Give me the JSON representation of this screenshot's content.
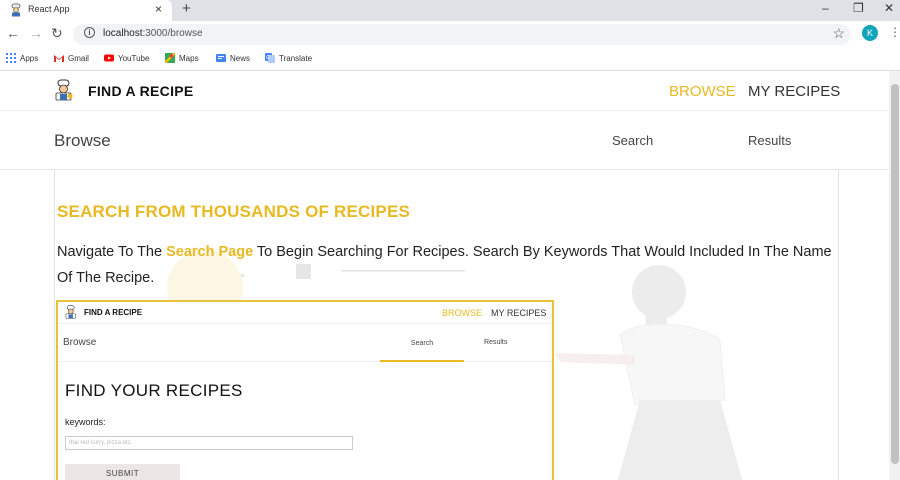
{
  "browser": {
    "tab_title": "React App",
    "tab_close": "×",
    "new_tab": "+",
    "url_host": "localhost",
    "url_path": ":3000/browse",
    "profile_initial": "K",
    "window_controls": [
      "–",
      "❐",
      "✕"
    ],
    "bookmarks": [
      {
        "label": "Apps",
        "icon": "apps-grid-icon",
        "color": "#4285f4"
      },
      {
        "label": "Gmail",
        "icon": "gmail-icon",
        "color": "#d93025"
      },
      {
        "label": "YouTube",
        "icon": "youtube-icon",
        "color": "#ff0000"
      },
      {
        "label": "Maps",
        "icon": "maps-icon",
        "color": "#34a853"
      },
      {
        "label": "News",
        "icon": "news-icon",
        "color": "#4285f4"
      },
      {
        "label": "Translate",
        "icon": "translate-icon",
        "color": "#4285f4"
      }
    ]
  },
  "app": {
    "brand": "FIND A RECIPE",
    "nav_browse": "BROWSE",
    "nav_my_recipes": "MY RECIPES",
    "sub_title": "Browse",
    "sub_search": "Search",
    "sub_results": "Results",
    "accent": "#e8b923"
  },
  "content": {
    "heading": "SEARCH FROM THOUSANDS OF RECIPES",
    "para_before": "Navigate To The ",
    "para_highlight": "Search Page",
    "para_after": " To Begin Searching For Recipes. Search By Keywords That Would Included In The Name Of The Recipe."
  },
  "screenshot": {
    "brand": "FIND A RECIPE",
    "nav_browse": "BROWSE",
    "nav_my_recipes": "MY RECIPES",
    "sub_title": "Browse",
    "tab_search": "Search",
    "tab_results": "Results",
    "find_heading": "FIND YOUR RECIPES",
    "keywords_label": "keywords:",
    "input_placeholder": "thai red curry, pizza etc.",
    "submit_label": "SUBMIT"
  }
}
